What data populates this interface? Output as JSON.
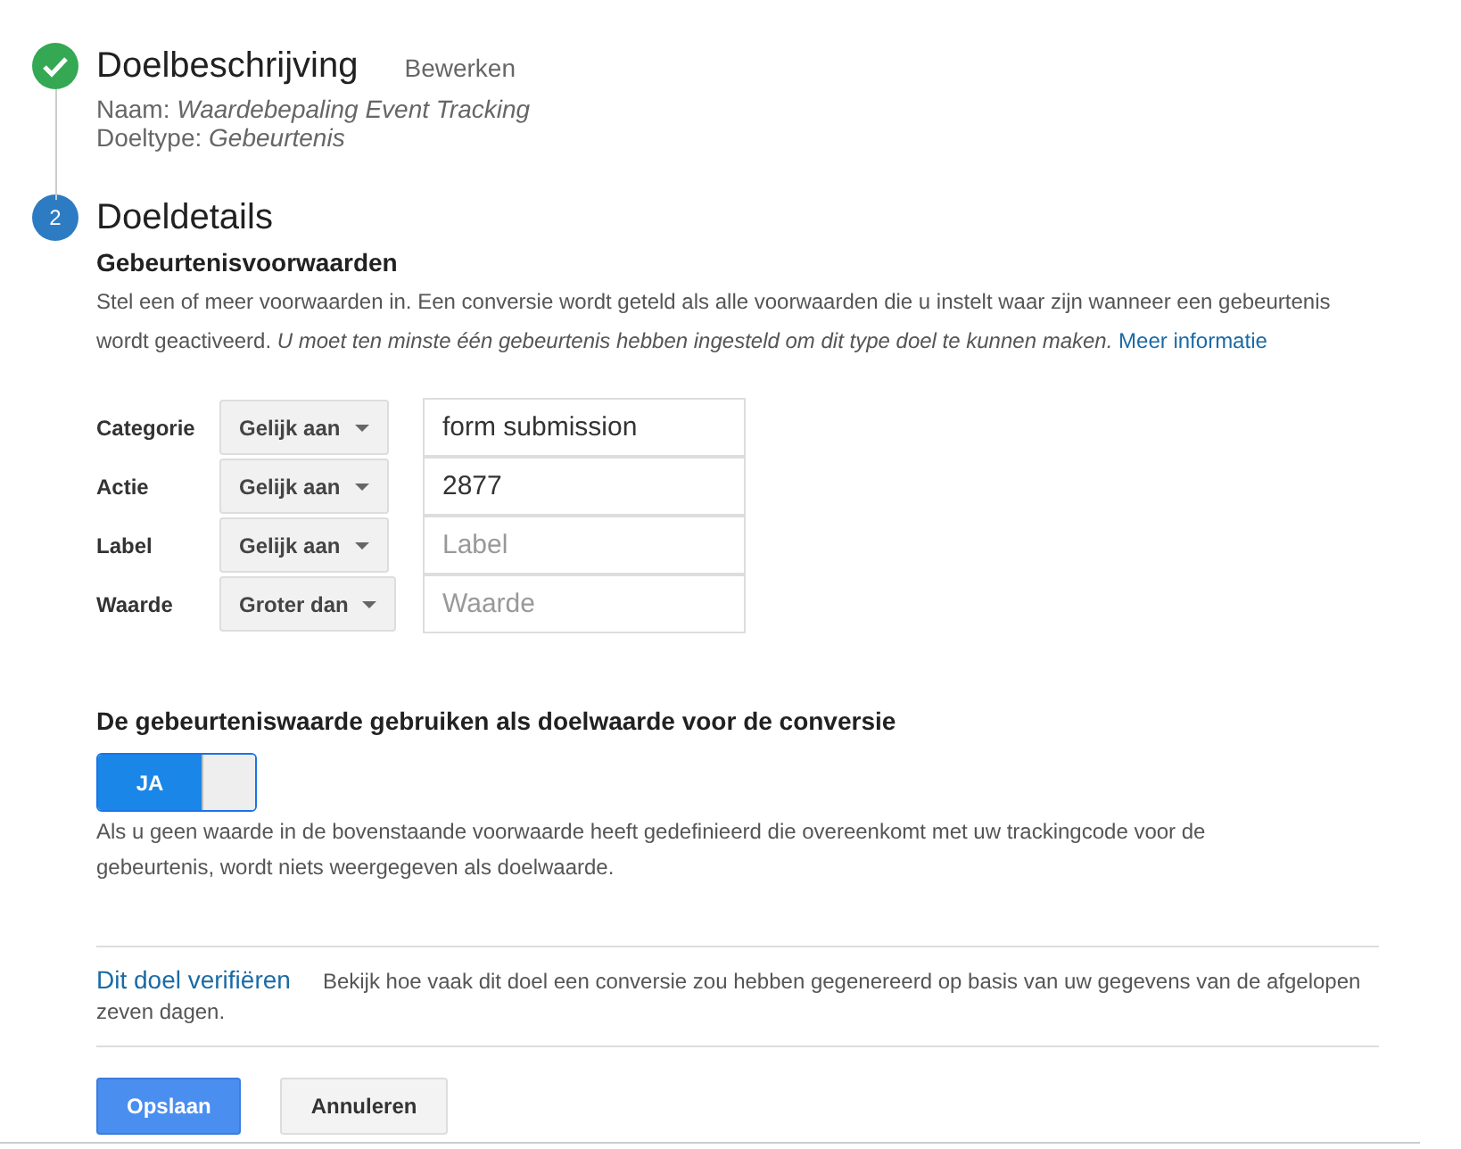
{
  "steps": [
    {
      "kind": "done",
      "title": "Doelbeschrijving",
      "edit_link": "Bewerken",
      "details": [
        {
          "label": "Naam:",
          "value": "Waardebepaling Event Tracking"
        },
        {
          "label": "Doeltype:",
          "value": "Gebeurtenis"
        }
      ]
    },
    {
      "kind": "current",
      "number": "2",
      "title": "Doeldetails"
    }
  ],
  "conditions": {
    "heading": "Gebeurtenisvoorwaarden",
    "description": "Stel een of meer voorwaarden in. Een conversie wordt geteld als alle voorwaarden die u instelt waar zijn wanneer een gebeurtenis wordt geactiveerd. *U moet ten minste één gebeurtenis hebben ingesteld om dit type doel te kunnen maken.*",
    "more_link": "Meer informatie",
    "rows": [
      {
        "label": "Categorie",
        "operator": "Gelijk aan",
        "value": "form submission"
      },
      {
        "label": "Actie",
        "operator": "Gelijk aan",
        "value": "2877"
      },
      {
        "label": "Label",
        "operator": "Gelijk aan",
        "placeholder": "Label"
      },
      {
        "label": "Waarde",
        "operator": "Groter dan",
        "placeholder": "Waarde"
      }
    ]
  },
  "value_toggle": {
    "heading": "De gebeurteniswaarde gebruiken als doelwaarde voor de conversie",
    "on": true,
    "on_label": "JA",
    "help": "Als u geen waarde in de bovenstaande voorwaarde heeft gedefinieerd die overeenkomt met uw trackingcode voor de gebeurtenis, wordt niets weergegeven als doelwaarde."
  },
  "verify": {
    "link": "Dit doel verifiëren",
    "text": "Bekijk hoe vaak dit doel een conversie zou hebben gegenereerd op basis van uw gegevens van de afgelopen zeven dagen."
  },
  "buttons": [
    {
      "kind": "primary",
      "label": "Opslaan"
    },
    {
      "kind": "secondary",
      "label": "Annuleren"
    }
  ]
}
